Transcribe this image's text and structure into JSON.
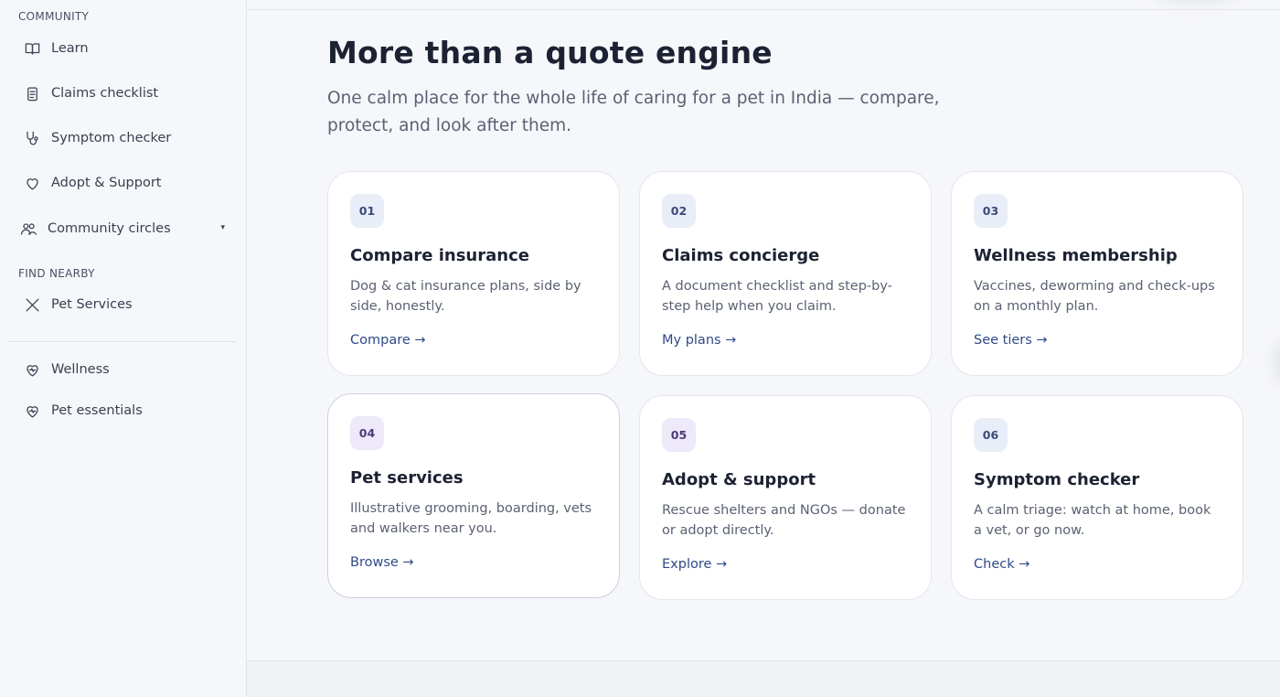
{
  "sidebar": {
    "community_label": "COMMUNITY",
    "find_nearby_label": "FIND NEARBY",
    "items": [
      {
        "label": "Learn",
        "icon": "book-icon"
      },
      {
        "label": "Claims checklist",
        "icon": "clipboard-icon"
      },
      {
        "label": "Symptom checker",
        "icon": "stethoscope-icon"
      },
      {
        "label": "Adopt & Support",
        "icon": "heart-icon"
      },
      {
        "label": "Community circles",
        "icon": "users-icon",
        "caret": "▾"
      },
      {
        "label": "Pet Services",
        "icon": "scissors-icon"
      },
      {
        "label": "Wellness",
        "icon": "heart-pulse-icon"
      },
      {
        "label": "Pet essentials",
        "icon": "heart-pulse-icon"
      }
    ]
  },
  "main": {
    "title": "More than a quote engine",
    "subtitle": "One calm place for the whole life of caring for a pet in India — compare, protect, and look after them.",
    "cards": [
      {
        "num": "01",
        "title": "Compare insurance",
        "desc": "Dog & cat insurance plans, side by side, honestly.",
        "link": "Compare →"
      },
      {
        "num": "02",
        "title": "Claims concierge",
        "desc": "A document checklist and step-by-step help when you claim.",
        "link": "My plans →"
      },
      {
        "num": "03",
        "title": "Wellness membership",
        "desc": "Vaccines, deworming and check-ups on a monthly plan.",
        "link": "See tiers →"
      },
      {
        "num": "04",
        "title": "Pet services",
        "desc": "Illustrative grooming, boarding, vets and walkers near you.",
        "link": "Browse →"
      },
      {
        "num": "05",
        "title": "Adopt & support",
        "desc": "Rescue shelters and NGOs — donate or adopt directly.",
        "link": "Explore →"
      },
      {
        "num": "06",
        "title": "Symptom checker",
        "desc": "A calm triage: watch at home, book a vet, or go now.",
        "link": "Check →"
      }
    ]
  },
  "colors": {
    "accent": "#2f4a86",
    "badge_bg": "#e9edf8",
    "sidebar_bg": "#f6f7fa"
  }
}
